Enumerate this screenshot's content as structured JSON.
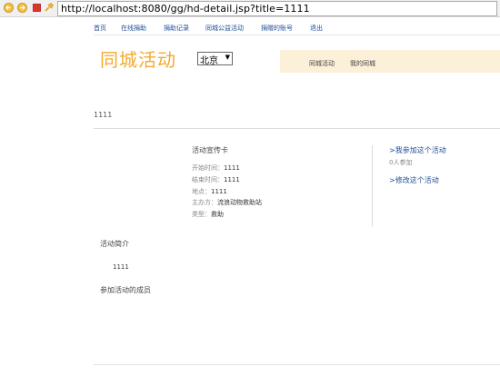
{
  "browser": {
    "url": "http://localhost:8080/gg/hd-detail.jsp?title=1111",
    "icons": [
      "back-icon",
      "forward-icon",
      "stop-icon",
      "refresh-icon"
    ]
  },
  "nav": {
    "items": [
      "首页",
      "在线捐助",
      "捐助记录",
      "同城公益活动",
      "捐赠的账号",
      "退出"
    ]
  },
  "header": {
    "site_title": "同城活动",
    "city": "北京",
    "subnav": [
      "同城活动",
      "我的同城"
    ]
  },
  "activity": {
    "title": "1111",
    "card": {
      "heading": "活动宣传卡",
      "rows": [
        {
          "label": "开始时间：",
          "value": "1111"
        },
        {
          "label": "结束时间：",
          "value": "1111"
        },
        {
          "label": "地点：",
          "value": "1111"
        },
        {
          "label": "主办方：",
          "value": "流浪动物救助站"
        },
        {
          "label": "类型：",
          "value": "救助"
        }
      ]
    },
    "actions": {
      "join": ">我参加这个活动",
      "joined_count": "0人参加",
      "edit": ">修改这个活动"
    },
    "intro_heading": "活动简介",
    "intro_text": "1111",
    "members_heading": "参加活动的成员"
  },
  "colors": {
    "title_orange": "#f4a92c",
    "link_blue": "#1f4e96",
    "subnav_bg": "#fdf0d8"
  }
}
